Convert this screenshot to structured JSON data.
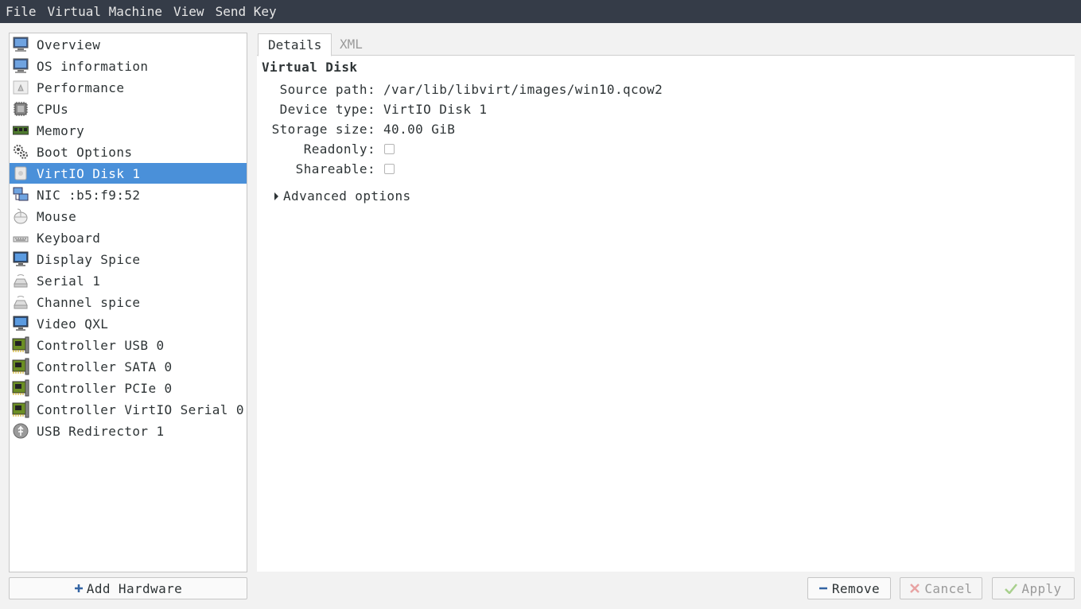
{
  "menubar": {
    "items": [
      "File",
      "Virtual Machine",
      "View",
      "Send Key"
    ]
  },
  "sidebar": {
    "items": [
      {
        "label": "Overview",
        "icon": "computer-icon"
      },
      {
        "label": "OS information",
        "icon": "computer-icon"
      },
      {
        "label": "Performance",
        "icon": "performance-icon"
      },
      {
        "label": "CPUs",
        "icon": "cpu-icon"
      },
      {
        "label": "Memory",
        "icon": "memory-icon"
      },
      {
        "label": "Boot Options",
        "icon": "gears-icon"
      },
      {
        "label": "VirtIO Disk 1",
        "icon": "disk-icon"
      },
      {
        "label": "NIC :b5:f9:52",
        "icon": "network-icon"
      },
      {
        "label": "Mouse",
        "icon": "mouse-icon"
      },
      {
        "label": "Keyboard",
        "icon": "keyboard-icon"
      },
      {
        "label": "Display Spice",
        "icon": "monitor-icon"
      },
      {
        "label": "Serial 1",
        "icon": "serial-icon"
      },
      {
        "label": "Channel spice",
        "icon": "serial-icon"
      },
      {
        "label": "Video QXL",
        "icon": "monitor-icon"
      },
      {
        "label": "Controller USB 0",
        "icon": "controller-icon"
      },
      {
        "label": "Controller SATA 0",
        "icon": "controller-icon"
      },
      {
        "label": "Controller PCIe 0",
        "icon": "controller-icon"
      },
      {
        "label": "Controller VirtIO Serial 0",
        "icon": "controller-icon"
      },
      {
        "label": "USB Redirector 1",
        "icon": "usb-icon"
      }
    ],
    "selected_index": 6
  },
  "add_hardware": {
    "label": "Add Hardware"
  },
  "tabs": [
    {
      "label": "Details",
      "active": true
    },
    {
      "label": "XML",
      "active": false
    }
  ],
  "details": {
    "title": "Virtual Disk",
    "source_path_label": "Source path:",
    "source_path_value": "/var/lib/libvirt/images/win10.qcow2",
    "device_type_label": "Device type:",
    "device_type_value": "VirtIO Disk 1",
    "storage_size_label": "Storage size:",
    "storage_size_value": "40.00 GiB",
    "readonly_label": "Readonly:",
    "readonly_checked": false,
    "shareable_label": "Shareable:",
    "shareable_checked": false,
    "advanced_label": "Advanced options"
  },
  "buttons": {
    "remove": "Remove",
    "cancel": "Cancel",
    "apply": "Apply"
  },
  "colors": {
    "selection": "#4a90d9",
    "menubar": "#353c48"
  }
}
